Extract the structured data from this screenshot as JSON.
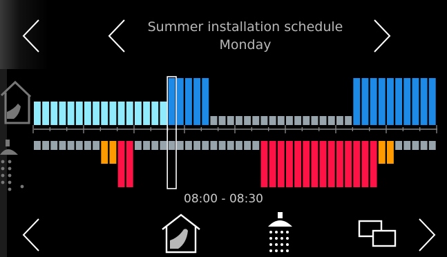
{
  "header": {
    "title": "Summer installation schedule",
    "day": "Monday"
  },
  "time_range": {
    "start": "08:00",
    "separator": "-",
    "end": "08:30"
  },
  "colors": {
    "heating_comfort": "#90ecfc",
    "heating_boost": "#1d8ae8",
    "heating_off": "#98a4ac",
    "water_off": "#98a4ac",
    "water_eco": "#ff9b00",
    "water_comfort": "#ff1245",
    "selection": "#ffffff"
  },
  "schedule": {
    "slots_per_day": 48,
    "selected_slot": 16,
    "heating": [
      "comfort",
      "comfort",
      "comfort",
      "comfort",
      "comfort",
      "comfort",
      "comfort",
      "comfort",
      "comfort",
      "comfort",
      "comfort",
      "comfort",
      "comfort",
      "comfort",
      "comfort",
      "comfort",
      "boost",
      "boost",
      "boost",
      "boost",
      "boost",
      "off",
      "off",
      "off",
      "off",
      "off",
      "off",
      "off",
      "off",
      "off",
      "off",
      "off",
      "off",
      "off",
      "off",
      "off",
      "off",
      "off",
      "boost",
      "boost",
      "boost",
      "boost",
      "boost",
      "boost",
      "boost",
      "boost",
      "boost",
      "boost",
      "boost"
    ],
    "water": [
      "off",
      "off",
      "off",
      "off",
      "off",
      "off",
      "off",
      "off",
      "eco",
      "eco",
      "comfort",
      "comfort",
      "off",
      "off",
      "off",
      "off",
      "off",
      "off",
      "off",
      "off",
      "off",
      "off",
      "off",
      "off",
      "off",
      "off",
      "off",
      "comfort",
      "comfort",
      "comfort",
      "comfort",
      "comfort",
      "comfort",
      "comfort",
      "comfort",
      "comfort",
      "comfort",
      "comfort",
      "comfort",
      "comfort",
      "comfort",
      "eco",
      "eco",
      "off",
      "off",
      "off",
      "off",
      "off"
    ]
  },
  "icons": {
    "prev_left": "chevron-left-icon",
    "prev_day": "chevron-left-icon",
    "next_day": "chevron-right-icon",
    "bottom_prev": "chevron-left-icon",
    "bottom_next": "chevron-right-icon",
    "heating_tab": "house-thermometer-icon",
    "water_tab": "shower-icon",
    "copy": "copy-windows-icon"
  }
}
